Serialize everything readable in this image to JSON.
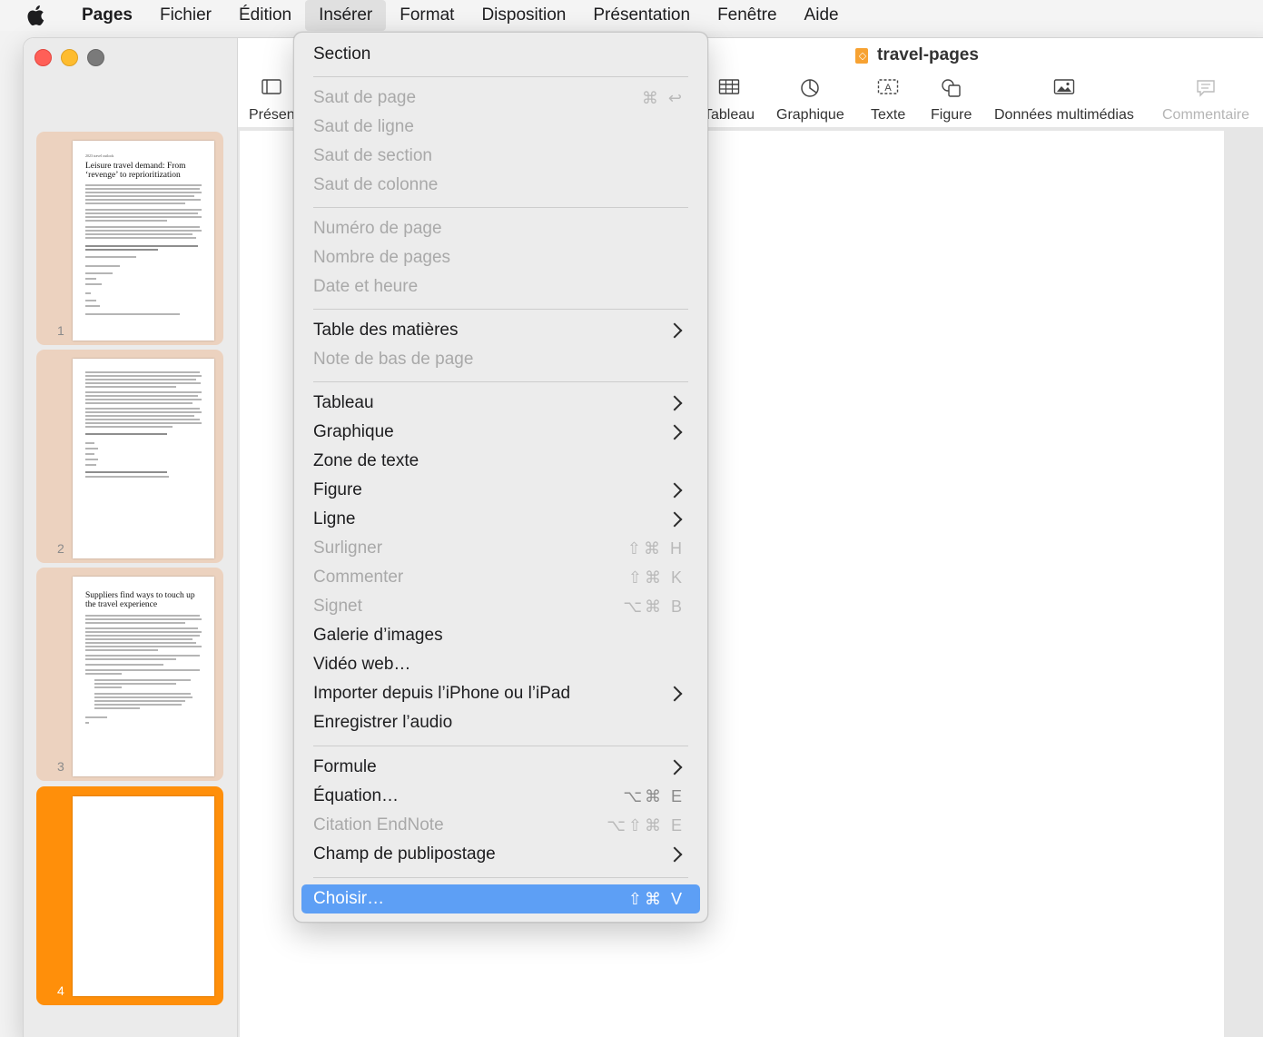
{
  "menubar": {
    "apple": "apple-logo",
    "app": "Pages",
    "items": [
      "Fichier",
      "Édition",
      "Insérer",
      "Format",
      "Disposition",
      "Présentation",
      "Fenêtre",
      "Aide"
    ]
  },
  "document": {
    "title": "travel-pages"
  },
  "toolbar": {
    "partial_left": "Présen",
    "tableau": "Tableau",
    "graphique": "Graphique",
    "texte": "Texte",
    "figure": "Figure",
    "media": "Données multimédias",
    "commentaire": "Commentaire"
  },
  "thumbnails": {
    "p1": {
      "num": "1",
      "kicker": "2023 travel outlook",
      "title": "Leisure travel demand: From ‘revenge’ to reprioritization"
    },
    "p2": {
      "num": "2"
    },
    "p3": {
      "num": "3",
      "title": "Suppliers find ways to touch up the travel experience"
    },
    "p4": {
      "num": "4"
    }
  },
  "menu": {
    "section": "Section",
    "saut_page": "Saut de page",
    "saut_page_sc": "⌘ ↩",
    "saut_ligne": "Saut de ligne",
    "saut_section": "Saut de section",
    "saut_colonne": "Saut de colonne",
    "numero_page": "Numéro de page",
    "nombre_pages": "Nombre de pages",
    "date_heure": "Date et heure",
    "table_matieres": "Table des matières",
    "note_bas": "Note de bas de page",
    "tableau": "Tableau",
    "graphique": "Graphique",
    "zone_texte": "Zone de texte",
    "figure": "Figure",
    "ligne": "Ligne",
    "surligner": "Surligner",
    "surligner_sc": "⇧⌘ H",
    "commenter": "Commenter",
    "commenter_sc": "⇧⌘ K",
    "signet": "Signet",
    "signet_sc": "⌥⌘ B",
    "galerie": "Galerie d’images",
    "video": "Vidéo web…",
    "importer": "Importer depuis l’iPhone ou l’iPad",
    "enregistrer": "Enregistrer l’audio",
    "formule": "Formule",
    "equation": "Équation…",
    "equation_sc": "⌥⌘ E",
    "citation": "Citation EndNote",
    "citation_sc": "⌥⇧⌘ E",
    "champ": "Champ de publipostage",
    "choisir": "Choisir…",
    "choisir_sc": "⇧⌘ V"
  },
  "colors": {
    "accent_orange": "#ff8f0a",
    "menu_highlight": "#5d9ff5"
  }
}
